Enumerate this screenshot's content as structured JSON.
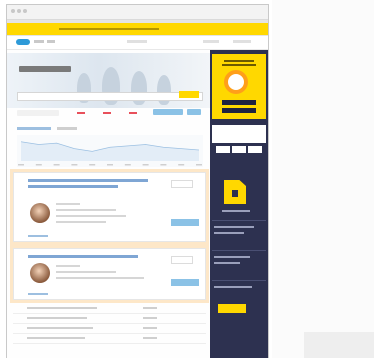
{
  "chart_data": {
    "type": "area",
    "x": [
      1,
      2,
      3,
      4,
      5,
      6,
      7,
      8,
      9,
      10,
      11
    ],
    "series": [
      {
        "values": [
          14,
          12,
          13,
          9,
          7,
          10,
          11,
          12,
          10,
          9,
          8
        ]
      }
    ]
  },
  "colors": {
    "accent_yellow": "#ffd800",
    "sidebar_navy": "#2d3150",
    "link_blue": "#2d6db5",
    "button_blue": "#8bc2e6",
    "card_highlight": "#fde7c8",
    "filter_red": "#e8505b"
  },
  "icons": {
    "logo": "cloud-logo-icon",
    "avatar": "user-avatar",
    "document": "document-icon",
    "ring": "progress-ring"
  }
}
